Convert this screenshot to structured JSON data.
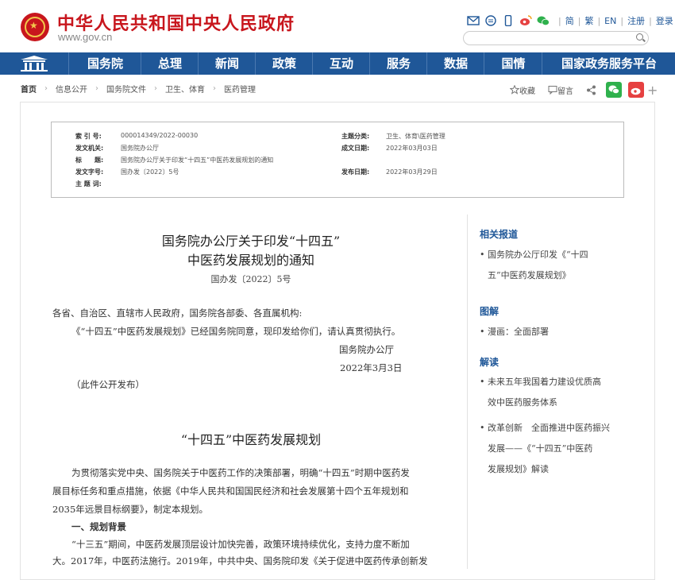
{
  "header": {
    "title": "中华人民共和国中央人民政府",
    "domain": "www.gov.cn",
    "emblem_glyph": "★",
    "tools": {
      "simplified": "简",
      "traditional": "繁",
      "english": "EN",
      "register": "注册",
      "login": "登录"
    }
  },
  "nav": {
    "items": [
      "国务院",
      "总理",
      "新闻",
      "政策",
      "互动",
      "服务",
      "数据",
      "国情",
      "国家政务服务平台"
    ]
  },
  "breadcrumb": [
    "首页",
    "信息公开",
    "国务院文件",
    "卫生、体育",
    "医药管理"
  ],
  "share": {
    "favorite": "收藏",
    "comment": "留言"
  },
  "meta": {
    "index_label": "索 引 号:",
    "index_value": "000014349/2022-00030",
    "topic_label": "主题分类:",
    "topic_value": "卫生、体育\\医药管理",
    "issuer_label": "发文机关:",
    "issuer_value": "国务院办公厅",
    "date_label": "成文日期:",
    "date_value": "2022年03月03日",
    "title_label": "标　　题:",
    "title_value": "国务院办公厅关于印发“十四五”中医药发展规划的通知",
    "docno_label": "发文字号:",
    "docno_value": "国办发〔2022〕5号",
    "pubdate_label": "发布日期:",
    "pubdate_value": "2022年03月29日",
    "keywords_label": "主 题 词:"
  },
  "article": {
    "title_line1": "国务院办公厅关于印发“十四五”",
    "title_line2": "中医药发展规划的通知",
    "doc_number": "国办发〔2022〕5号",
    "salutation": "各省、自治区、直辖市人民政府，国务院各部委、各直属机构:",
    "body1": "《“十四五”中医药发展规划》已经国务院同意，现印发给你们，请认真贯彻执行。",
    "signature": "国务院办公厅",
    "sign_date": "2022年3月3日",
    "public_note": "（此件公开发布）",
    "plan_title": "“十四五”中医药发展规划",
    "intro_l1": "为贯彻落实党中央、国务院关于中医药工作的决策部署，明确“十四五”时期中医药发",
    "intro_l2": "展目标任务和重点措施，依据《中华人民共和国国民经济和社会发展第十四个五年规划和",
    "intro_l3": "2035年远景目标纲要》，制定本规划。",
    "section1": "一、规划背景",
    "bg_l1": "“十三五”期间，中医药发展顶层设计加快完善，政策环境持续优化，支持力度不断加",
    "bg_l2": "大。2017年，中医药法施行。2019年，中共中央、国务院印发《关于促进中医药传承创新发"
  },
  "sidebar": {
    "related_heading": "相关报道",
    "related_l1": "国务院办公厅印发《“十四",
    "related_l2": "五”中医药发展规划》",
    "graphic_heading": "图解",
    "graphic_item": "漫画：全面部署",
    "interpret_heading": "解读",
    "interp1_l1": "未来五年我国着力建设优质高",
    "interp1_l2": "效中医药服务体系",
    "interp2_l1": "改革创新　全面推进中医药振兴",
    "interp2_l2": "发展——《“十四五”中医药",
    "interp2_l3": "发展规划》解读",
    "bullet": "•"
  }
}
